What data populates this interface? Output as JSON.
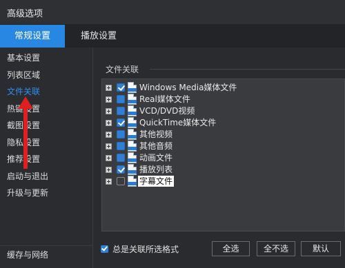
{
  "window": {
    "title": "高级选项"
  },
  "tabs": [
    {
      "label": "常规设置",
      "active": true
    },
    {
      "label": "播放设置",
      "active": false
    }
  ],
  "sidebar": {
    "items": [
      {
        "label": "基本设置"
      },
      {
        "label": "列表区域"
      },
      {
        "label": "文件关联",
        "active": true
      },
      {
        "label": "热键设置"
      },
      {
        "label": "截图设置"
      },
      {
        "label": "隐私设置"
      },
      {
        "label": "推荐设置"
      },
      {
        "label": "启动与退出"
      },
      {
        "label": "升级与更新"
      }
    ],
    "bottom_item": {
      "label": "缓存与网络"
    }
  },
  "main": {
    "group_label": "文件关联",
    "list": [
      {
        "label": "Windows Media媒体文件",
        "checked": true,
        "icon": "ASF"
      },
      {
        "label": "Real媒体文件",
        "checked": true,
        "icon": "RM"
      },
      {
        "label": "VCD/DVD视频",
        "checked": true,
        "icon": "DAT"
      },
      {
        "label": "QuickTime媒体文件",
        "checked": true,
        "icon": "QT"
      },
      {
        "label": "其他视频",
        "checked": true,
        "icon": "AVI"
      },
      {
        "label": "其他音频",
        "checked": true,
        "icon": "MP3"
      },
      {
        "label": "动画文件",
        "checked": true,
        "icon": "FLV"
      },
      {
        "label": "播放列表",
        "checked": true,
        "icon": "LIST"
      },
      {
        "label": "字幕文件",
        "checked": false,
        "icon": "SRT",
        "selected": true
      }
    ],
    "always_associate_label": "总是关联所选格式",
    "buttons": {
      "select_all": "全选",
      "select_none": "全不选",
      "default": "默认"
    }
  },
  "colors": {
    "accent": "#2787e3",
    "active_text": "#2e8ff0",
    "annotation_arrow": "#e02020"
  }
}
